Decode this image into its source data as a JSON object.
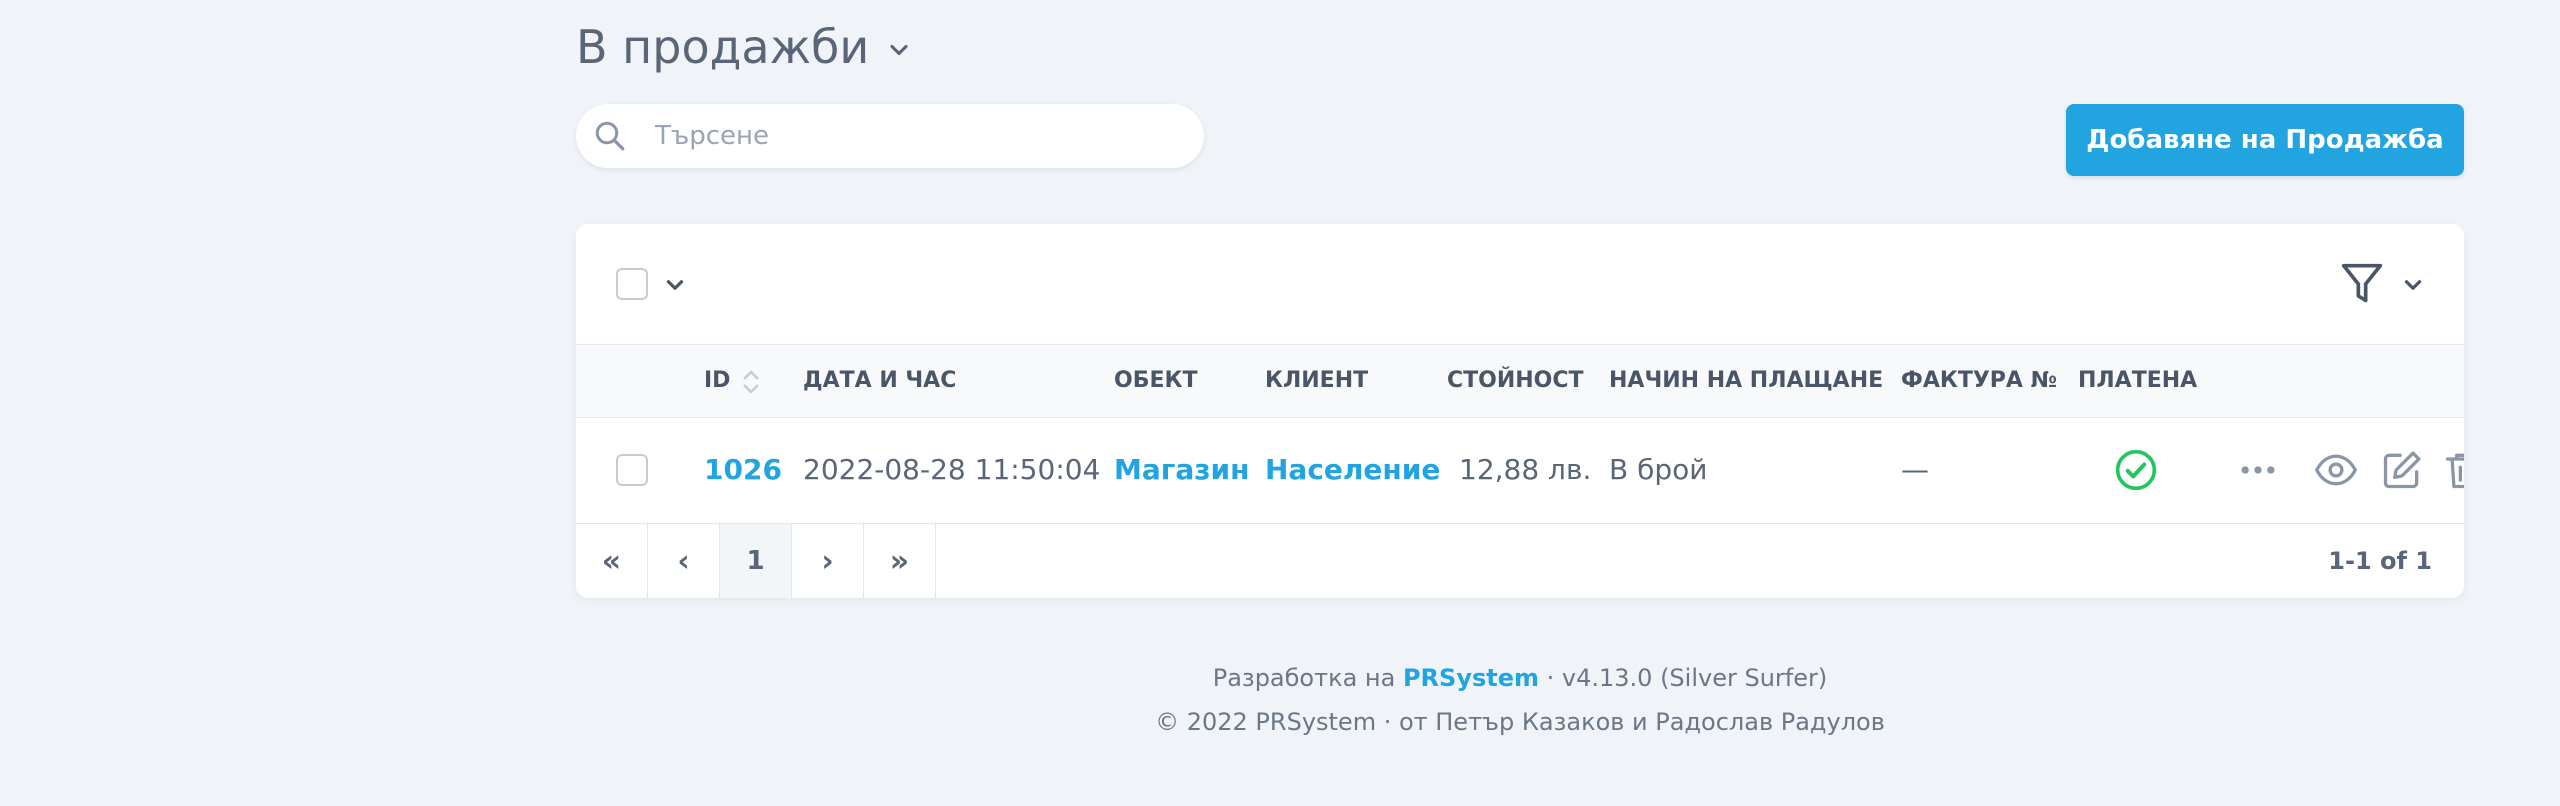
{
  "page": {
    "title": "В продажби"
  },
  "search": {
    "placeholder": "Търсене",
    "value": ""
  },
  "actions": {
    "add_label": "Добавяне на Продажба"
  },
  "table": {
    "columns": {
      "id": "ID",
      "datetime": "ДАТА И ЧАС",
      "object": "ОБЕКТ",
      "client": "КЛИЕНТ",
      "value": "СТОЙНОСТ",
      "payment_method": "НАЧИН НА ПЛАЩАНЕ",
      "invoice": "ФАКТУРА №",
      "paid": "ПЛАТЕНА"
    },
    "rows": [
      {
        "id": "1026",
        "datetime": "2022-08-28 11:50:04",
        "object": "Магазин",
        "client": "Население",
        "value": "12,88 лв.",
        "payment_method": "В брой",
        "invoice": "—",
        "paid": true
      }
    ]
  },
  "pagination": {
    "first": "«",
    "prev": "‹",
    "current": "1",
    "next": "›",
    "last": "»",
    "info": "1-1 of 1"
  },
  "footer": {
    "line1_prefix": "Разработка на ",
    "brand": "PRSystem",
    "line1_suffix": " · v4.13.0 (Silver Surfer)",
    "line2": "© 2022 PRSystem · от Петър Казаков и Радослав Радулов"
  },
  "colors": {
    "accent": "#21a4e0",
    "success": "#22c55e",
    "background": "#f0f4f8"
  },
  "icons": {
    "title_dropdown": "chevron-down-icon",
    "search": "search-icon",
    "filter": "filter-icon",
    "sort": "sort-icon",
    "paid": "check-circle-icon",
    "more": "more-icon",
    "view": "eye-icon",
    "edit": "edit-icon",
    "delete": "trash-icon"
  }
}
